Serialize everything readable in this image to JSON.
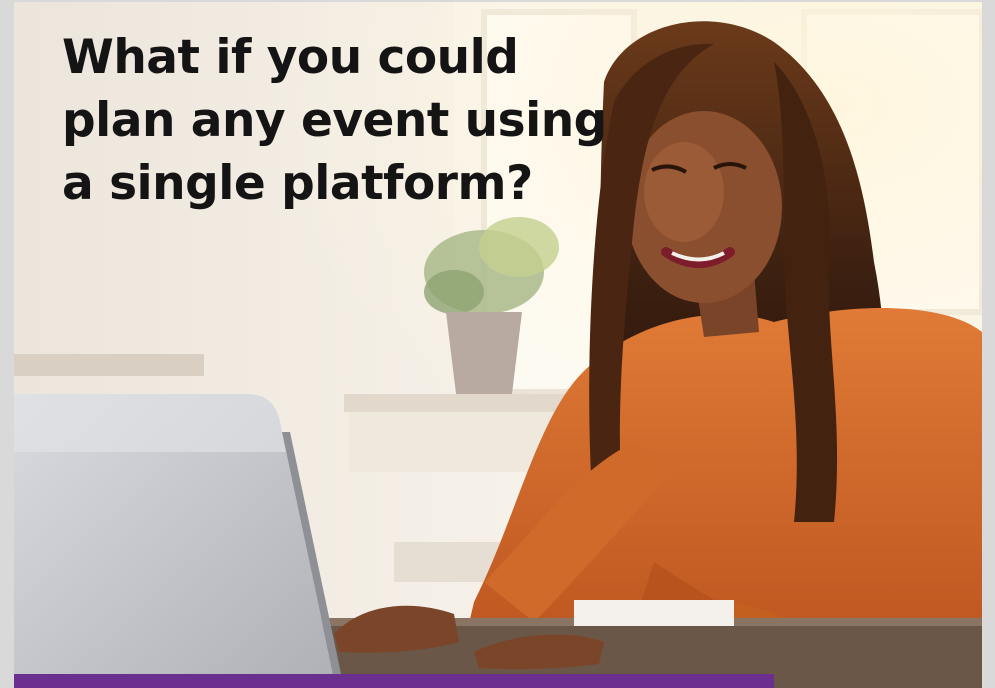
{
  "hero": {
    "headline_lines": [
      "What if you could",
      "plan any event using",
      "a single platform?"
    ]
  },
  "image": {
    "description_icon": "woman-using-laptop-photo"
  },
  "colors": {
    "accent_bar": "#6b2f8f",
    "headline_text": "#141414",
    "wall": "#efe7dc",
    "sweater": "#d76a2c",
    "laptop": "#c9cacf"
  }
}
